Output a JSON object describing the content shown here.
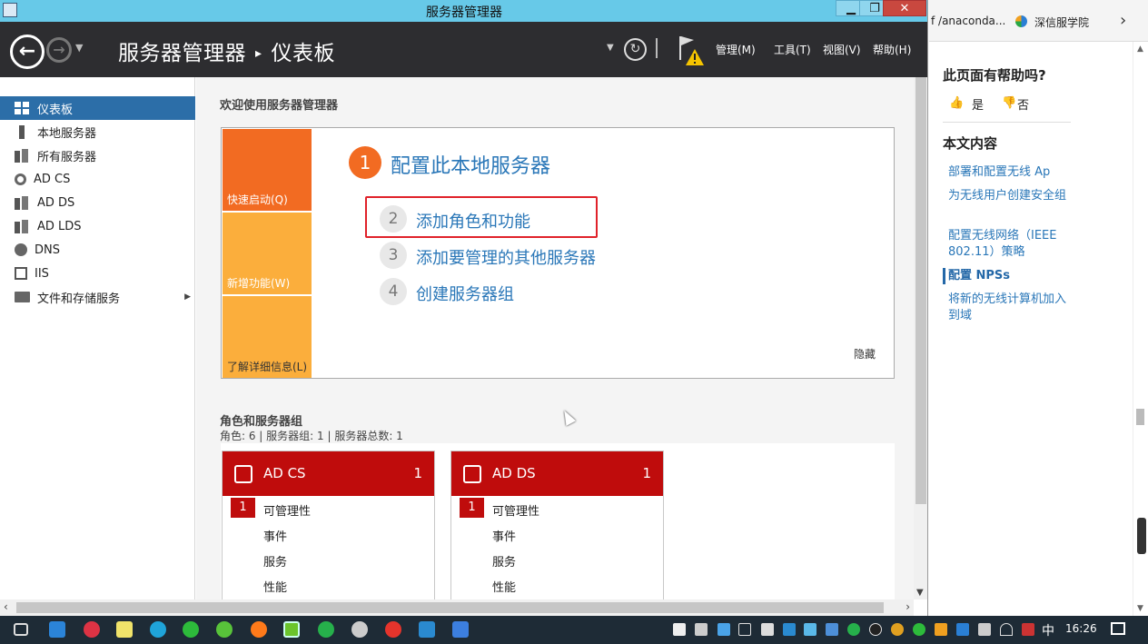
{
  "window": {
    "title": "服务器管理器",
    "minimize": "▁",
    "maximize": "❐",
    "close": "✕"
  },
  "header": {
    "breadcrumb_root": "服务器管理器",
    "breadcrumb_sep": "▸",
    "breadcrumb_current": "仪表板",
    "menus": {
      "manage": "管理(M)",
      "tools": "工具(T)",
      "view": "视图(V)",
      "help": "帮助(H)"
    }
  },
  "sidebar": {
    "items": [
      {
        "label": "仪表板",
        "icon": "dashboard-icon"
      },
      {
        "label": "本地服务器",
        "icon": "server-icon"
      },
      {
        "label": "所有服务器",
        "icon": "servers-icon"
      },
      {
        "label": "AD CS",
        "icon": "certificate-icon"
      },
      {
        "label": "AD DS",
        "icon": "directory-icon"
      },
      {
        "label": "AD LDS",
        "icon": "directory-icon"
      },
      {
        "label": "DNS",
        "icon": "dns-icon"
      },
      {
        "label": "IIS",
        "icon": "iis-icon"
      },
      {
        "label": "文件和存储服务",
        "icon": "folder-icon"
      }
    ],
    "active_index": 0
  },
  "welcome": {
    "title": "欢迎使用服务器管理器",
    "tiles": {
      "quick_start": "快速启动(Q)",
      "whats_new": "新增功能(W)",
      "learn_more": "了解详细信息(L)"
    },
    "steps": [
      {
        "num": "1",
        "label": "配置此本地服务器"
      },
      {
        "num": "2",
        "label": "添加角色和功能"
      },
      {
        "num": "3",
        "label": "添加要管理的其他服务器"
      },
      {
        "num": "4",
        "label": "创建服务器组"
      }
    ],
    "hide": "隐藏"
  },
  "roles": {
    "title": "角色和服务器组",
    "summary": "角色: 6 | 服务器组: 1 | 服务器总数: 1",
    "cards": [
      {
        "name": "AD CS",
        "count": "1",
        "manageability_badge": "1",
        "manageability": "可管理性",
        "events": "事件",
        "services": "服务",
        "performance": "性能"
      },
      {
        "name": "AD DS",
        "count": "1",
        "manageability_badge": "1",
        "manageability": "可管理性",
        "events": "事件",
        "services": "服务",
        "performance": "性能"
      }
    ]
  },
  "browser": {
    "bookmark1": "f /anaconda...",
    "bookmark2": "深信服学院",
    "more": "›",
    "helpful_question": "此页面有帮助吗?",
    "yes": "是",
    "no": "否",
    "toc_title": "本文内容",
    "toc": [
      "部署和配置无线 Ap",
      "为无线用户创建安全组",
      "配置无线网络（IEEE 802.11）策略",
      "配置 NPSs",
      "将新的无线计算机加入到域"
    ],
    "toc_active_index": 3
  },
  "taskbar": {
    "ime": "中",
    "time": "16:26"
  },
  "colors": {
    "titlebar": "#67c9e8",
    "header": "#2d2d30",
    "accent_orange": "#f26b22",
    "tile_yellow": "#fbae3c",
    "role_red": "#bf0c0c",
    "link_blue": "#2a77b8",
    "sidebar_active": "#2c6ea8",
    "highlight_box": "#e0222a"
  }
}
